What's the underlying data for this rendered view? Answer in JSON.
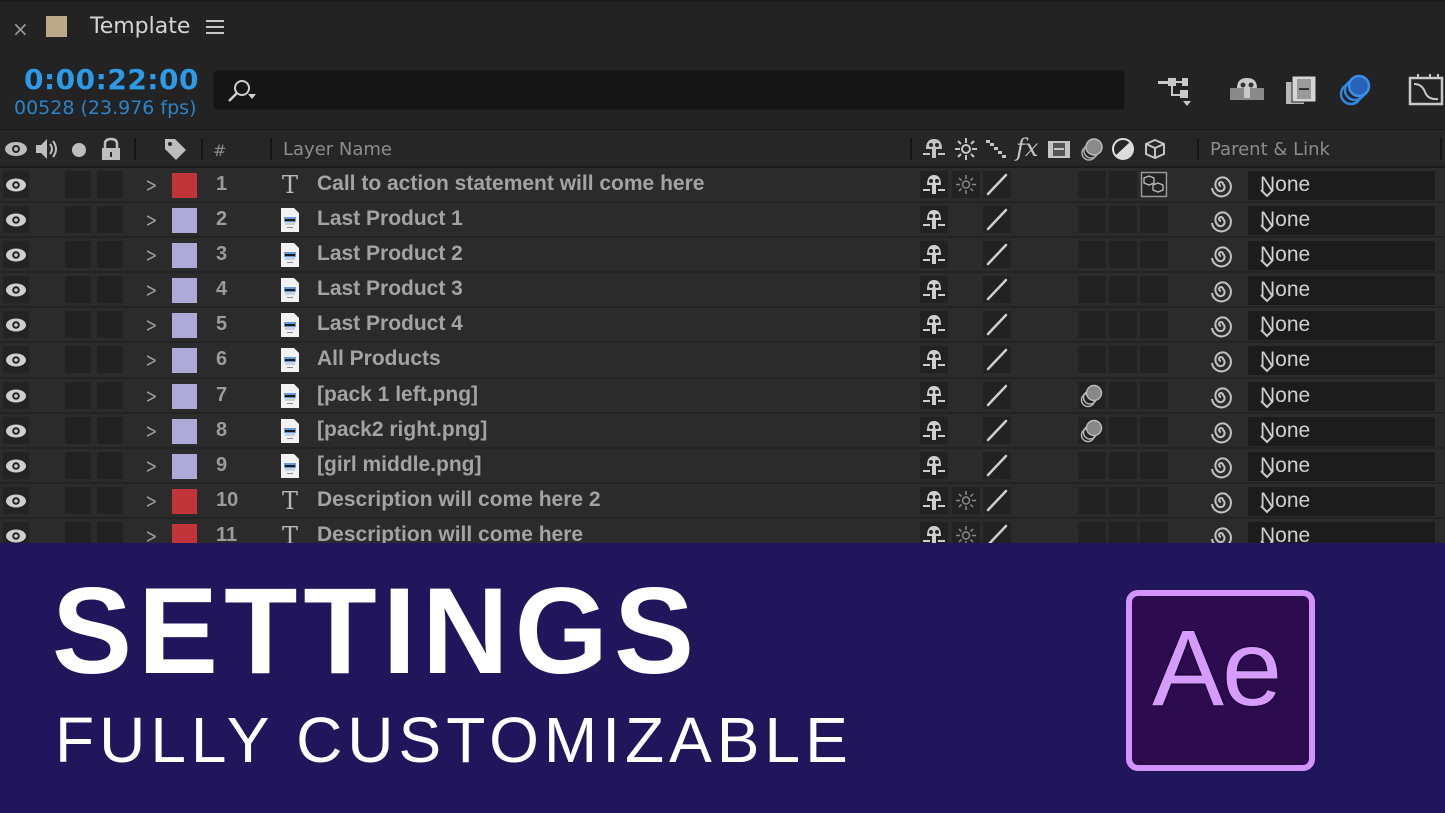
{
  "tab": {
    "title": "Template",
    "swatch_color": "#bba98a",
    "close_icon": "close-icon",
    "menu_icon": "hamburger-menu-icon"
  },
  "toolbar": {
    "timecode": "0:00:22:00",
    "frames": "00528 (23.976 fps)",
    "search_value": "",
    "search_placeholder": "",
    "icons": [
      "composition-flowchart-icon",
      "shy-layers-icon",
      "frame-blending-icon",
      "motion-blur-icon",
      "graph-editor-icon"
    ]
  },
  "header": {
    "hash": "#",
    "layer_name": "Layer Name",
    "parent_link": "Parent & Link"
  },
  "colors": {
    "accent": "#2d9ae8",
    "label_red": "#c0343a",
    "label_lavender": "#aeaad8",
    "banner_bg": "#21165c",
    "ae_border": "#d294fb",
    "ae_bg": "#2c0b4f"
  },
  "layers": [
    {
      "num": "1",
      "name": "Call to action statement will come here",
      "type": "text",
      "label": "red",
      "collapse": true,
      "motion_blur": false,
      "threeD": true,
      "parent": "None"
    },
    {
      "num": "2",
      "name": "Last Product 1",
      "type": "footage",
      "label": "lavender",
      "collapse": false,
      "motion_blur": false,
      "threeD": false,
      "parent": "None"
    },
    {
      "num": "3",
      "name": "Last Product 2",
      "type": "footage",
      "label": "lavender",
      "collapse": false,
      "motion_blur": false,
      "threeD": false,
      "parent": "None"
    },
    {
      "num": "4",
      "name": "Last Product 3",
      "type": "footage",
      "label": "lavender",
      "collapse": false,
      "motion_blur": false,
      "threeD": false,
      "parent": "None"
    },
    {
      "num": "5",
      "name": "Last Product 4",
      "type": "footage",
      "label": "lavender",
      "collapse": false,
      "motion_blur": false,
      "threeD": false,
      "parent": "None"
    },
    {
      "num": "6",
      "name": "All Products",
      "type": "footage",
      "label": "lavender",
      "collapse": false,
      "motion_blur": false,
      "threeD": false,
      "parent": "None"
    },
    {
      "num": "7",
      "name": "[pack 1 left.png]",
      "type": "footage",
      "label": "lavender",
      "collapse": false,
      "motion_blur": true,
      "threeD": false,
      "parent": "None"
    },
    {
      "num": "8",
      "name": "[pack2 right.png]",
      "type": "footage",
      "label": "lavender",
      "collapse": false,
      "motion_blur": true,
      "threeD": false,
      "parent": "None"
    },
    {
      "num": "9",
      "name": "[girl middle.png]",
      "type": "footage",
      "label": "lavender",
      "collapse": false,
      "motion_blur": false,
      "threeD": false,
      "parent": "None"
    },
    {
      "num": "10",
      "name": "Description will come here 2",
      "type": "text",
      "label": "red",
      "collapse": true,
      "motion_blur": false,
      "threeD": false,
      "parent": "None"
    },
    {
      "num": "11",
      "name": "Description will come here",
      "type": "text",
      "label": "red",
      "collapse": true,
      "motion_blur": false,
      "threeD": false,
      "parent": "None"
    }
  ],
  "banner": {
    "title": "SETTINGS",
    "subtitle": "FULLY CUSTOMIZABLE",
    "logo_text": "Ae"
  }
}
